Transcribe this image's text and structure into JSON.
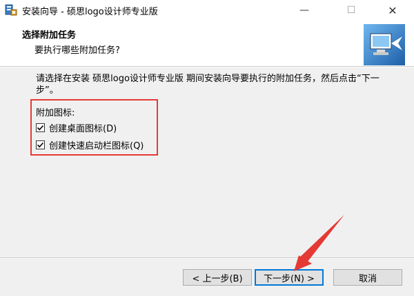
{
  "window": {
    "title": "安装向导 - 硕思logo设计师专业版",
    "minimize_glyph": "—",
    "maximize_glyph": "☐",
    "close_glyph": "✕"
  },
  "header": {
    "title": "选择附加任务",
    "subtitle": "要执行哪些附加任务?"
  },
  "main": {
    "description": "请选择在安装 硕思logo设计师专业版 期间安装向导要执行的附加任务，然后点击“下一步”。",
    "group_label": "附加图标:",
    "tasks": [
      {
        "label": "创建桌面图标(D)",
        "checked": true
      },
      {
        "label": "创建快速启动栏图标(Q)",
        "checked": true
      }
    ]
  },
  "buttons": {
    "back": "< 上一步(B)",
    "next": "下一步(N) >",
    "cancel": "取消"
  },
  "colors": {
    "highlight": "#e53935",
    "annotation_arrow": "#e53935",
    "default_button_border": "#0078d7"
  },
  "icons": {
    "app": "installer-icon",
    "header": "computer-install-icon",
    "annotation": "red-arrow-icon"
  }
}
